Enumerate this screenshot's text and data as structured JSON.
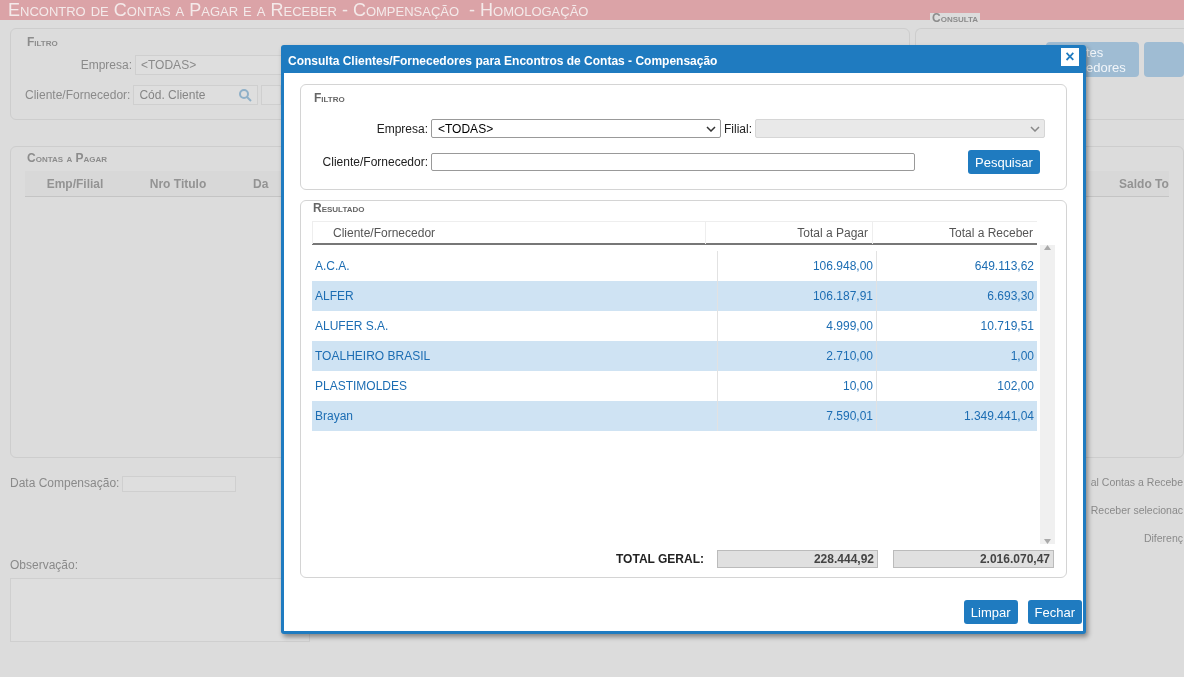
{
  "page_title": "Encontro de Contas a Pagar e a Receber - Compensação  - Homologação",
  "filter": {
    "title": "Filtro",
    "empresa_label": "Empresa:",
    "empresa_value": "<TODAS>",
    "cliente_label": "Cliente/Fornecedor:",
    "cliente_placeholder": "Cód. Cliente"
  },
  "consulta": {
    "title": "Consulta",
    "button_lines": [
      "tes",
      "edores"
    ]
  },
  "contas_a_pagar": {
    "title": "Contas a Pagar",
    "columns": [
      "Emp/Filial",
      "Nro Titulo",
      "Da"
    ],
    "right_column": "Saldo To"
  },
  "data_compensacao_label": "Data Compensação:",
  "totals_labels": [
    "al Contas a Recebe",
    "Receber selecionac",
    "Diferenç"
  ],
  "observacao_label": "Observação:",
  "dialog": {
    "title": "Consulta Clientes/Fornecedores para Encontros de Contas - Compensação",
    "close": "×",
    "filter": {
      "title": "Filtro",
      "empresa_label": "Empresa:",
      "empresa_value": "<TODAS>",
      "filial_label": "Filial:",
      "cliente_label": "Cliente/Fornecedor:",
      "search_button": "Pesquisar"
    },
    "result": {
      "title": "Resultado",
      "columns": [
        "Cliente/Fornecedor",
        "Total a Pagar",
        "Total a Receber"
      ],
      "rows": [
        {
          "name": "A.C.A.",
          "pagar": "106.948,00",
          "receber": "649.113,62"
        },
        {
          "name": "ALFER",
          "pagar": "106.187,91",
          "receber": "6.693,30"
        },
        {
          "name": "ALUFER S.A.",
          "pagar": "4.999,00",
          "receber": "10.719,51"
        },
        {
          "name": "TOALHEIRO BRASIL",
          "pagar": "2.710,00",
          "receber": "1,00"
        },
        {
          "name": "PLASTIMOLDES",
          "pagar": "10,00",
          "receber": "102,00"
        },
        {
          "name": "Brayan",
          "pagar": "7.590,01",
          "receber": "1.349.441,04"
        }
      ],
      "total_label": "TOTAL GERAL:",
      "total_pagar": "228.444,92",
      "total_receber": "2.016.070,47"
    },
    "buttons": [
      "Limpar",
      "Fechar"
    ]
  }
}
